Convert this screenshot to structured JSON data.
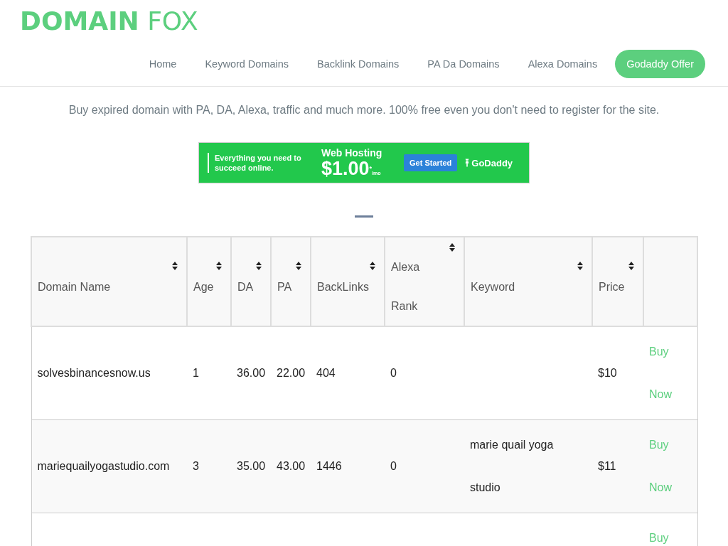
{
  "logo": {
    "bold": "DOMAIN",
    "light": "FOX"
  },
  "nav": [
    {
      "label": "Home",
      "kind": "link"
    },
    {
      "label": "Keyword Domains",
      "kind": "link"
    },
    {
      "label": "Backlink Domains",
      "kind": "link"
    },
    {
      "label": "PA Da Domains",
      "kind": "link"
    },
    {
      "label": "Alexa Domains",
      "kind": "link"
    },
    {
      "label": "Godaddy Offer",
      "kind": "pill"
    }
  ],
  "tagline": "Buy expired domain with PA, DA, Alexa, traffic and much more. 100% free even you don't need to register for the site.",
  "ad": {
    "lead": "Everything you need to succeed online.",
    "product": "Web Hosting",
    "price": "$1.00",
    "price_mark": "*",
    "per": "/mo",
    "button": "Get Started",
    "brand": "GoDaddy"
  },
  "table": {
    "columns": [
      "Domain Name",
      "Age",
      "DA",
      "PA",
      "BackLinks",
      "Alexa Rank",
      "Keyword",
      "Price",
      ""
    ],
    "rows": [
      {
        "cells": [
          "solvesbinancesnow.us",
          "1",
          "36.00",
          "22.00",
          "404",
          "0",
          "",
          "$10"
        ],
        "action": "Buy Now"
      },
      {
        "cells": [
          "mariequailyogastudio.com",
          "3",
          "35.00",
          "43.00",
          "1446",
          "0",
          "marie quail yoga studio",
          "$11"
        ],
        "action": "Buy Now"
      },
      {
        "cells": [
          "",
          "",
          "",
          "",
          "",
          "",
          "",
          ""
        ],
        "action": "Buy"
      }
    ]
  }
}
